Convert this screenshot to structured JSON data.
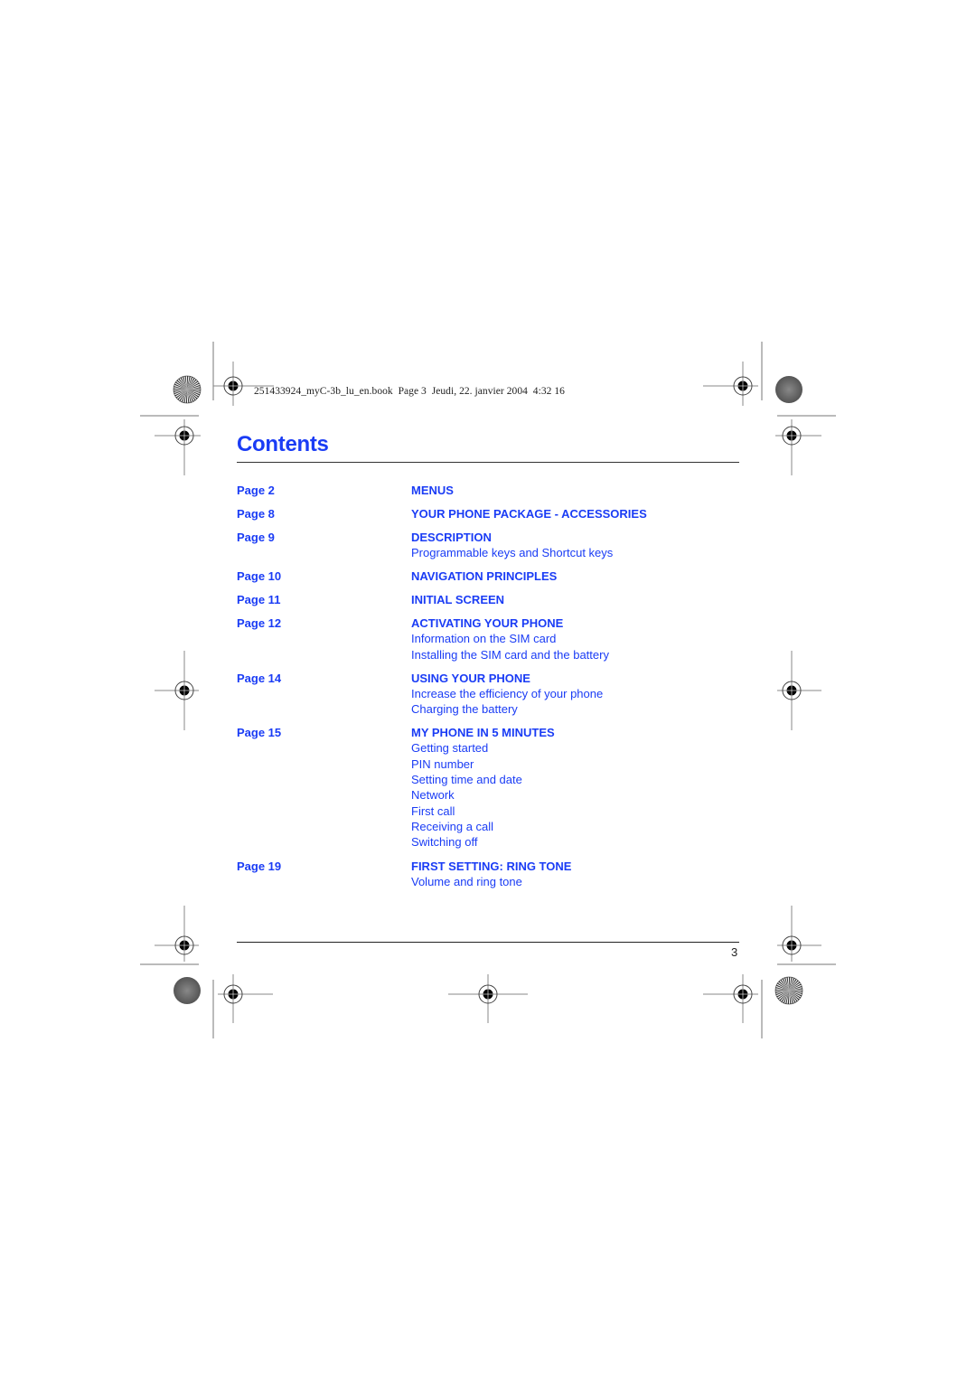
{
  "header": {
    "book_info": "251433924_myC-3b_lu_en.book  Page 3  Jeudi, 22. janvier 2004  4:32 16"
  },
  "title": "Contents",
  "colors": {
    "accent": "#1a3cf5",
    "text": "#222222",
    "rule": "#333333"
  },
  "toc": [
    {
      "page": "Page 2",
      "heading": "MENUS",
      "subs": []
    },
    {
      "page": "Page 8",
      "heading": "YOUR PHONE PACKAGE - ACCESSORIES",
      "subs": []
    },
    {
      "page": "Page 9",
      "heading": "DESCRIPTION",
      "subs": [
        "Programmable keys and  Shortcut keys"
      ]
    },
    {
      "page": "Page 10",
      "heading": "NAVIGATION PRINCIPLES",
      "subs": []
    },
    {
      "page": "Page 11",
      "heading": "INITIAL SCREEN",
      "subs": []
    },
    {
      "page": "Page 12",
      "heading": "ACTIVATING YOUR PHONE",
      "subs": [
        "Information on the SIM card",
        "Installing the SIM card and the battery"
      ]
    },
    {
      "page": "Page 14",
      "heading": "USING YOUR PHONE",
      "subs": [
        "Increase the efficiency of your phone",
        "Charging the battery"
      ]
    },
    {
      "page": "Page 15",
      "heading": "MY PHONE IN 5 MINUTES",
      "subs": [
        "Getting started",
        "PIN number",
        "Setting time and date",
        "Network",
        "First call",
        "Receiving a call",
        "Switching off"
      ]
    },
    {
      "page": "Page 19",
      "heading": "FIRST SETTING: RING TONE",
      "subs": [
        "Volume and ring tone"
      ]
    }
  ],
  "footer": {
    "page_number": "3"
  },
  "icons": {
    "registration_mark": "registration-crosshair-icon",
    "starburst_mark": "starburst-target-icon",
    "gray_disc_mark": "gray-disc-icon"
  }
}
